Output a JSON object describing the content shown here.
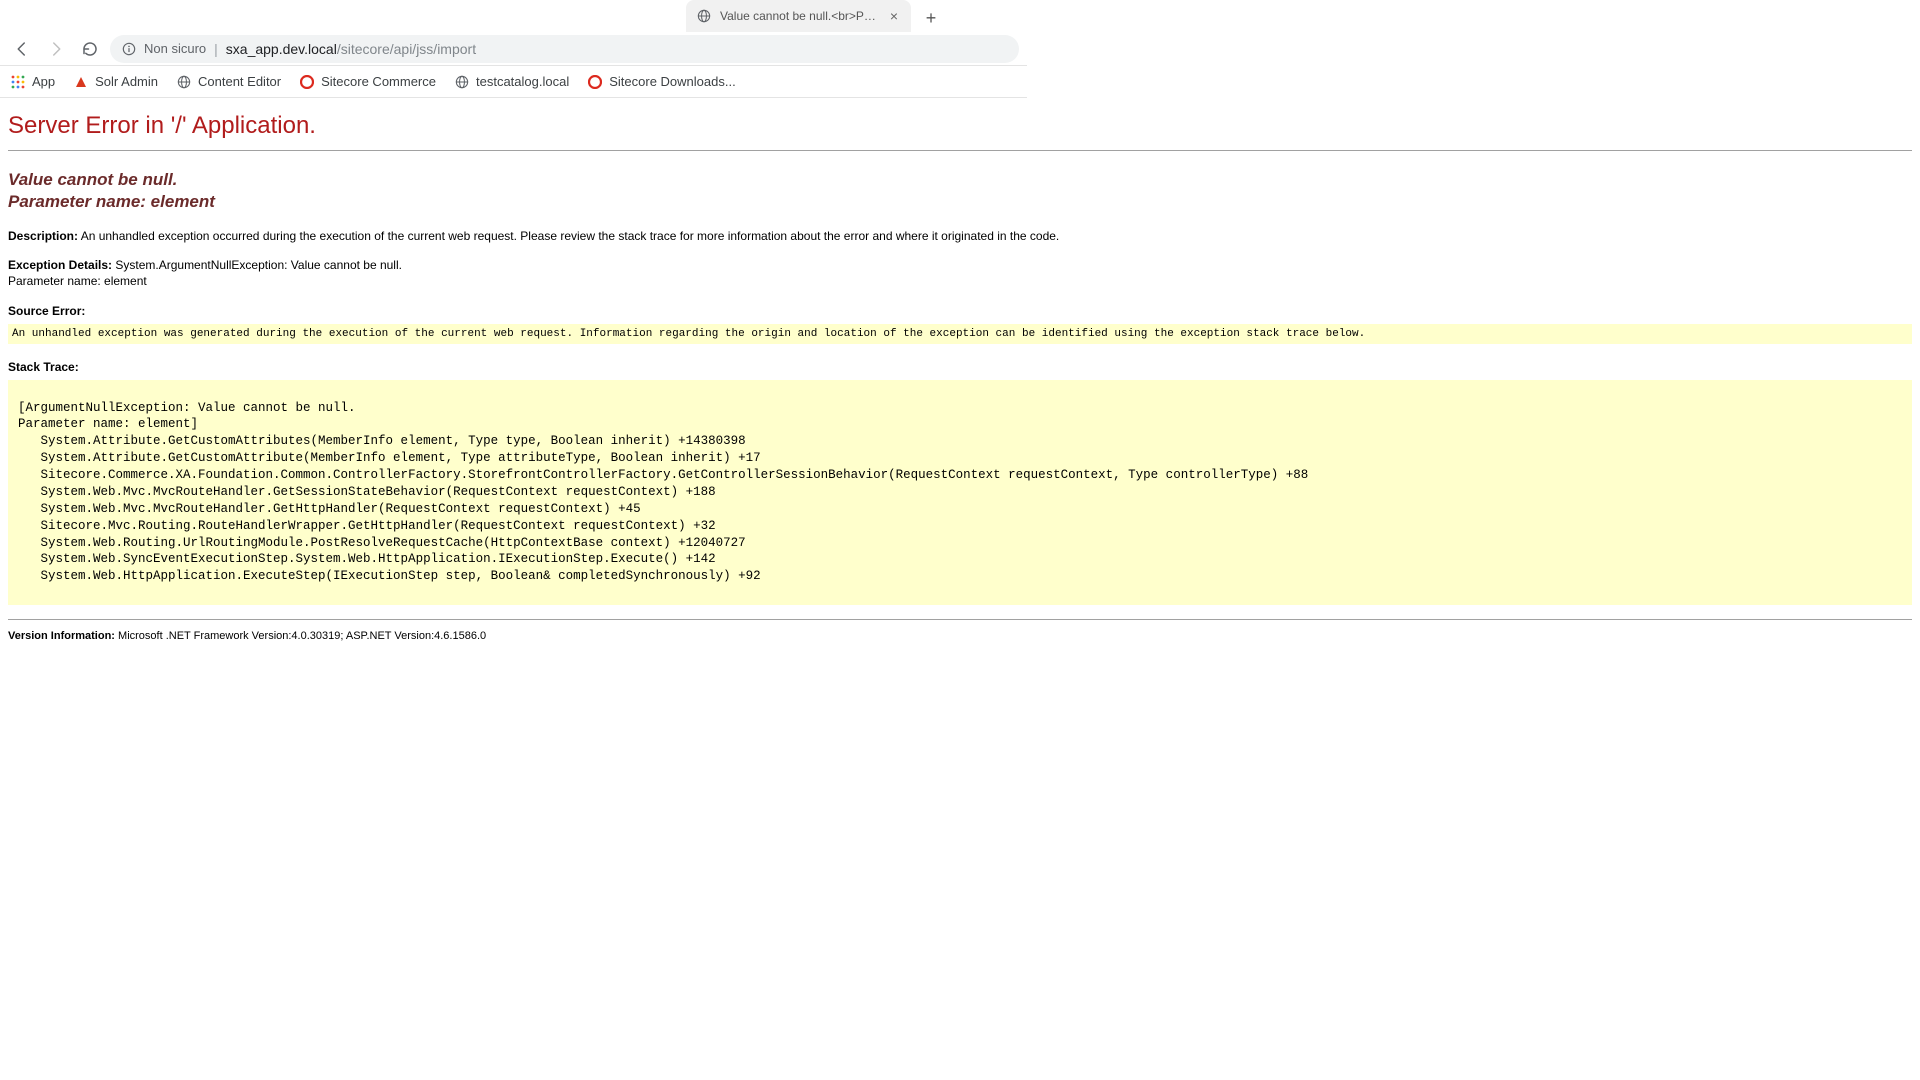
{
  "tab": {
    "title": "Value cannot be null.<br>Param…"
  },
  "address": {
    "security_label": "Non sicuro",
    "url_host": "sxa_app.dev.local",
    "url_path": "/sitecore/api/jss/import"
  },
  "bookmarks": [
    {
      "label": "App",
      "icon": "apps-grid"
    },
    {
      "label": "Solr Admin",
      "icon": "solr"
    },
    {
      "label": "Content Editor",
      "icon": "globe"
    },
    {
      "label": "Sitecore Commerce",
      "icon": "sitecore"
    },
    {
      "label": "testcatalog.local",
      "icon": "globe"
    },
    {
      "label": "Sitecore Downloads...",
      "icon": "sitecore"
    }
  ],
  "error": {
    "title": "Server Error in '/' Application.",
    "subtitle_line1": "Value cannot be null.",
    "subtitle_line2": "Parameter name: element",
    "description_label": "Description:",
    "description_text": "An unhandled exception occurred during the execution of the current web request. Please review the stack trace for more information about the error and where it originated in the code.",
    "exception_label": "Exception Details:",
    "exception_text": "System.ArgumentNullException: Value cannot be null.",
    "exception_param": "Parameter name: element",
    "source_error_label": "Source Error:",
    "source_error_text": "An unhandled exception was generated during the execution of the current web request. Information regarding the origin and location of the exception can be identified using the exception stack trace below.",
    "stack_trace_label": "Stack Trace:",
    "stack_trace": "[ArgumentNullException: Value cannot be null.\nParameter name: element]\n   System.Attribute.GetCustomAttributes(MemberInfo element, Type type, Boolean inherit) +14380398\n   System.Attribute.GetCustomAttribute(MemberInfo element, Type attributeType, Boolean inherit) +17\n   Sitecore.Commerce.XA.Foundation.Common.ControllerFactory.StorefrontControllerFactory.GetControllerSessionBehavior(RequestContext requestContext, Type controllerType) +88\n   System.Web.Mvc.MvcRouteHandler.GetSessionStateBehavior(RequestContext requestContext) +188\n   System.Web.Mvc.MvcRouteHandler.GetHttpHandler(RequestContext requestContext) +45\n   Sitecore.Mvc.Routing.RouteHandlerWrapper.GetHttpHandler(RequestContext requestContext) +32\n   System.Web.Routing.UrlRoutingModule.PostResolveRequestCache(HttpContextBase context) +12040727\n   System.Web.SyncEventExecutionStep.System.Web.HttpApplication.IExecutionStep.Execute() +142\n   System.Web.HttpApplication.ExecuteStep(IExecutionStep step, Boolean& completedSynchronously) +92",
    "version_label": "Version Information:",
    "version_text": "Microsoft .NET Framework Version:4.0.30319; ASP.NET Version:4.6.1586.0"
  }
}
